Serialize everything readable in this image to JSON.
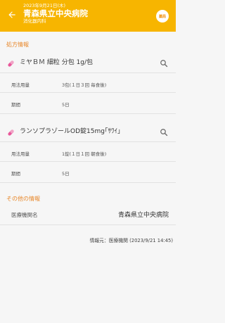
{
  "header": {
    "date": "2023年9月21日(木)",
    "title": "青森県立中央病院",
    "department": "消化器内科",
    "category_badge": "薬局",
    "background_color": "#f7b500"
  },
  "prescription": {
    "section_label": "処方情報",
    "medications": [
      {
        "name": "ミヤＢＭ 細粒 分包 1g/包",
        "dosage_label": "用法用量",
        "dosage_value": "3包(１日３回  毎食後)",
        "period_label": "期間",
        "period_value": "5日"
      },
      {
        "name": "ランソプラゾールOD錠15mg｢ｻﾜｲ｣",
        "dosage_label": "用法用量",
        "dosage_value": "1錠(１日１回  朝食後)",
        "period_label": "期間",
        "period_value": "5日"
      }
    ]
  },
  "other": {
    "section_label": "その他の情報",
    "institution_label": "医療機関名",
    "institution_value": "青森県立中央病院"
  },
  "source_text": "情報元：医療機関 (2023/9/21 14:45)",
  "colors": {
    "accent": "#e8892d",
    "pill": "#e8579a"
  }
}
